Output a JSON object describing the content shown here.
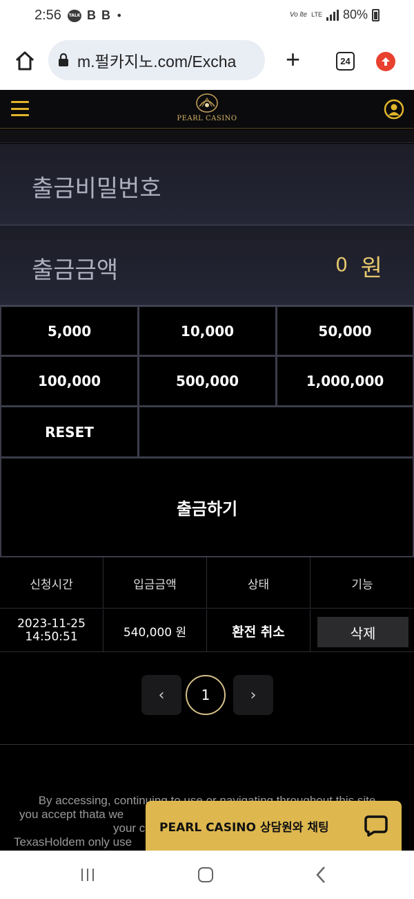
{
  "status_bar": {
    "time": "2:56",
    "talk_badge": "TALK",
    "notification_letters": [
      "B",
      "B"
    ],
    "carrier": "Vo lte",
    "network": "LTE",
    "battery": "80%"
  },
  "browser": {
    "url": "m.펄카지노.com/Excha",
    "tab_count": "24"
  },
  "header": {
    "logo_text": "PEARL CASINO"
  },
  "form": {
    "password_label": "출금비밀번호",
    "amount_label": "출금금액",
    "amount_value": "0",
    "amount_unit": "원",
    "amount_buttons": [
      "5,000",
      "10,000",
      "50,000",
      "100,000",
      "500,000",
      "1,000,000"
    ],
    "reset_label": "RESET",
    "submit_label": "출금하기"
  },
  "table": {
    "headers": [
      "신청시간",
      "입금금액",
      "상태",
      "기능"
    ],
    "rows": [
      {
        "date": "2023-11-25",
        "time": "14:50:51",
        "amount": "540,000 원",
        "status": "환전 취소",
        "action": "삭제"
      }
    ]
  },
  "pagination": {
    "prev": "‹",
    "current": "1",
    "next": "›"
  },
  "footer": {
    "line1": "By accessing, continuing to use or navigating throughout this site",
    "line2": "you accept thata we",
    "line3": "your c",
    "line4": "TexasHoldem only use"
  },
  "chat": {
    "label": "PEARL CASINO 상담원와 채팅"
  },
  "colors": {
    "accent_gold": "#deb84f",
    "amount_gold": "#e4c66d",
    "update_red": "#e8412f"
  }
}
